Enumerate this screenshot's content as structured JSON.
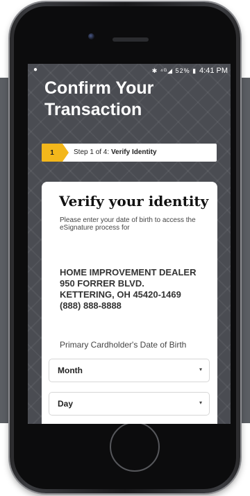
{
  "status_bar": {
    "left_icon": "notification-dot",
    "icons": "✱ ⁴ᴳ◢ 52% ▮",
    "time": "4:41 PM"
  },
  "page": {
    "title": "Confirm Your Transaction"
  },
  "step": {
    "number": "1",
    "prefix": "Step 1 of 4: ",
    "name": "Verify Identity"
  },
  "card": {
    "title": "Verify your identity",
    "instructions": "Please enter your date of birth to access the eSignature process for",
    "dealer_lines": [
      "HOME IMPROVEMENT DEALER",
      "950 FORRER BLVD.",
      "KETTERING, OH  45420-1469",
      "(888) 888-8888"
    ],
    "dob_label": "Primary Cardholder's Date of Birth",
    "month_select": {
      "value": "Month",
      "arrow": "▾"
    },
    "day_select": {
      "value": "Day",
      "arrow": "▾"
    }
  },
  "colors": {
    "accent": "#f3b71b",
    "background": "#4a4c52",
    "card": "#ffffff"
  }
}
